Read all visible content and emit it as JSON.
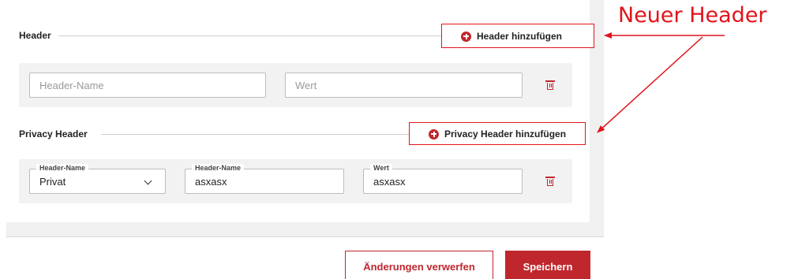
{
  "header_section": {
    "title": "Header",
    "add_button": "Header hinzufügen",
    "name_placeholder": "Header-Name",
    "value_placeholder": "Wert"
  },
  "privacy_section": {
    "title": "Privacy Header",
    "add_button": "Privacy Header hinzufügen",
    "row": {
      "select_label": "Header-Name",
      "select_value": "Privat",
      "name_label": "Header-Name",
      "name_value": "asxasx",
      "value_label": "Wert",
      "value_value": "asxasx"
    }
  },
  "footer": {
    "discard_label": "Änderungen verwerfen",
    "save_label": "Speichern"
  },
  "annotation": {
    "text": "Neuer Header",
    "color": "#e2141b"
  },
  "colors": {
    "accent": "#c0272d",
    "row_background": "#f2f2f2"
  },
  "icons": [
    "plus-circle-icon",
    "trash-icon",
    "chevron-down-icon"
  ]
}
